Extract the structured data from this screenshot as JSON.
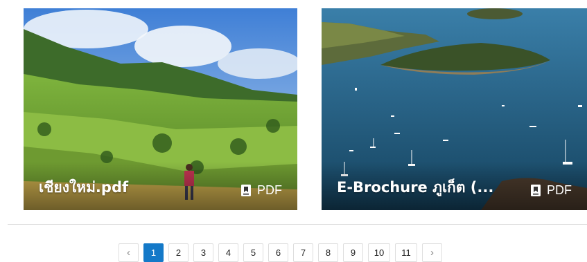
{
  "cards": [
    {
      "title": "เชียงใหม่.pdf",
      "type_label": "PDF",
      "icon": "bookmark-document-icon"
    },
    {
      "title": "E-Brochure ภูเก็ต (...",
      "type_label": "PDF",
      "icon": "bookmark-document-icon"
    }
  ],
  "pagination": {
    "prev": "‹",
    "next": "›",
    "pages": [
      "1",
      "2",
      "3",
      "4",
      "5",
      "6",
      "7",
      "8",
      "9",
      "10",
      "11"
    ],
    "current": "1",
    "accent_color": "#1479c8"
  }
}
